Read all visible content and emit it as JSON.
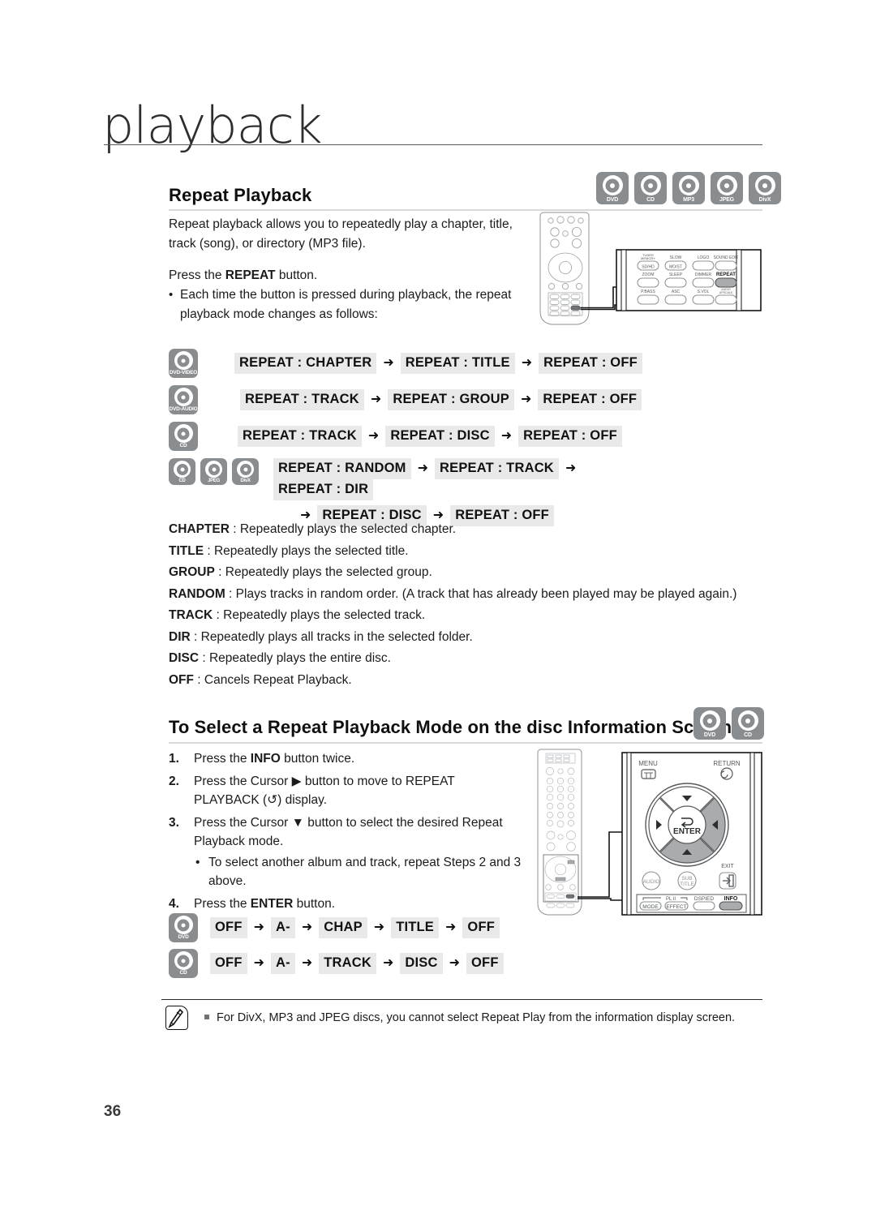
{
  "chapter": {
    "title": "playback",
    "page_number": "36"
  },
  "section1": {
    "heading": "Repeat Playback",
    "disc_badges": [
      "DVD",
      "CD",
      "MP3",
      "JPEG",
      "DivX"
    ],
    "intro_line1": "Repeat playback allows you to repeatedly play a chapter, title,",
    "intro_line2": "track (song), or directory (MP3 file).",
    "press_prefix": "Press the ",
    "press_bold": "REPEAT",
    "press_suffix": " button.",
    "bullet_line1": "Each time the button is pressed during playback, the repeat",
    "bullet_line2": "playback mode changes as follows:",
    "sequences": [
      {
        "icons": [
          "DVD-VIDEO"
        ],
        "steps": [
          "REPEAT : CHAPTER",
          "REPEAT : TITLE",
          "REPEAT : OFF"
        ]
      },
      {
        "icons": [
          "DVD-AUDIO"
        ],
        "steps": [
          "REPEAT : TRACK",
          "REPEAT : GROUP",
          "REPEAT : OFF"
        ]
      },
      {
        "icons": [
          "CD"
        ],
        "steps": [
          "REPEAT : TRACK",
          "REPEAT : DISC",
          "REPEAT : OFF"
        ]
      },
      {
        "icons": [
          "CD",
          "JPEG",
          "DivX"
        ],
        "steps": [
          "REPEAT : RANDOM",
          "REPEAT : TRACK",
          "REPEAT : DIR",
          "REPEAT : DISC",
          "REPEAT : OFF"
        ]
      }
    ],
    "definitions": [
      {
        "term": "CHAPTER",
        "desc": " : Repeatedly plays the selected chapter."
      },
      {
        "term": "TITLE",
        "desc": " : Repeatedly plays the selected title."
      },
      {
        "term": "GROUP",
        "desc": " : Repeatedly plays the selected group."
      },
      {
        "term": "RANDOM",
        "desc": " : Plays tracks in random order. (A track that has already been played may be played again.)"
      },
      {
        "term": "TRACK",
        "desc": " : Repeatedly plays the selected track."
      },
      {
        "term": "DIR",
        "desc": " : Repeatedly plays all tracks in the selected folder."
      },
      {
        "term": "DISC",
        "desc": " : Repeatedly plays the entire disc."
      },
      {
        "term": "OFF",
        "desc": " : Cancels Repeat Playback."
      }
    ],
    "remote_callout": {
      "buttons": [
        {
          "top": "TUNER MEMORY",
          "face": "SD/HD"
        },
        {
          "top": "SLOW",
          "face": "MO/ST"
        },
        {
          "top": "LOGO",
          "face": ""
        },
        {
          "top": "SOUND EDIT",
          "face": ""
        },
        {
          "top": "ZOOM",
          "face": ""
        },
        {
          "top": "SLEEP",
          "face": ""
        },
        {
          "top": "DIMMER",
          "face": ""
        },
        {
          "top": "REPEAT",
          "face": "",
          "highlighted": true
        },
        {
          "top": "P.BASS",
          "face": ""
        },
        {
          "top": "ASC",
          "face": ""
        },
        {
          "top": "S.VOL",
          "face": ""
        },
        {
          "top": "AUDIO UPSCALE",
          "face": ""
        }
      ]
    }
  },
  "section2": {
    "heading": "To Select a Repeat Playback Mode on the disc Information Screen",
    "disc_badges": [
      "DVD",
      "CD"
    ],
    "steps": [
      {
        "num": "1.",
        "text": "Press the ",
        "bold": "INFO",
        "text2": " button twice."
      },
      {
        "num": "2.",
        "text": "Press the Cursor ▶ button to move to REPEAT",
        "text2": "PLAYBACK (↺) display."
      },
      {
        "num": "3.",
        "text": "Press the Cursor ▼ button to select the desired Repeat",
        "text2": "Playback mode.",
        "sub": "To select another album and track, repeat Steps 2 and 3 above."
      },
      {
        "num": "4.",
        "text": "Press the ",
        "bold": "ENTER",
        "text2": " button."
      }
    ],
    "sequences": [
      {
        "icons": [
          "DVD"
        ],
        "steps": [
          "OFF",
          "A-",
          "CHAP",
          "TITLE",
          "OFF"
        ]
      },
      {
        "icons": [
          "CD"
        ],
        "steps": [
          "OFF",
          "A-",
          "TRACK",
          "DISC",
          "OFF"
        ]
      }
    ],
    "remote_callout": {
      "menu_label": "MENU",
      "return_label": "RETURN",
      "enter_label": "ENTER",
      "exit_label": "EXIT",
      "audio_label": "AUDIO",
      "subtitle_label": "SUB TITLE",
      "plii_label": "PL II",
      "mode_label": "MODE",
      "effect_label": "EFFECT",
      "dsp_label": "DSPIED",
      "info_label": "INFO"
    }
  },
  "note": {
    "text": "For DivX, MP3 and JPEG discs, you cannot select Repeat Play from the information display screen."
  },
  "colors": {
    "disc_badge_bg": "#8a8d90",
    "chip_bg": "#e9e9e9",
    "highlight_gray": "#a9abad",
    "rule_gray": "#d6d8da",
    "text": "#1b1b1b"
  }
}
